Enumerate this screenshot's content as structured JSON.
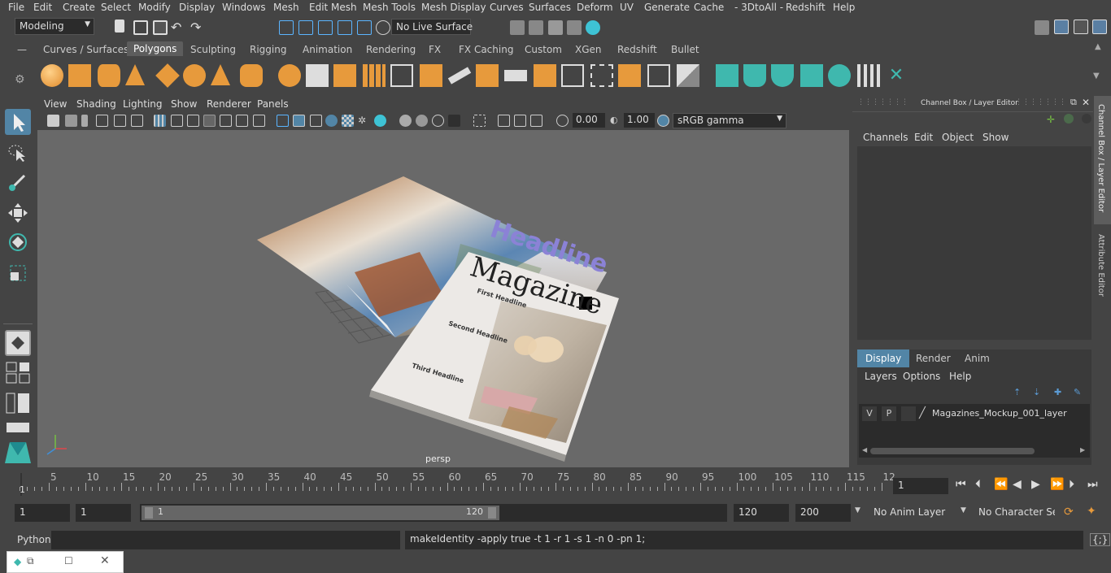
{
  "menubar": {
    "items": [
      "File",
      "Edit",
      "Create",
      "Select",
      "Modify",
      "Display",
      "Windows",
      "Mesh",
      "Edit Mesh",
      "Mesh Tools",
      "Mesh Display",
      "Curves",
      "Surfaces",
      "Deform",
      "UV",
      "Generate",
      "Cache",
      "- 3DtoAll -",
      "Redshift",
      "Help"
    ]
  },
  "statusline": {
    "mode": "Modeling",
    "live_surface": "No Live Surface"
  },
  "shelf": {
    "tabs": [
      "Curves / Surfaces",
      "Polygons",
      "Sculpting",
      "Rigging",
      "Animation",
      "Rendering",
      "FX",
      "FX Caching",
      "Custom",
      "XGen",
      "Redshift",
      "Bullet"
    ],
    "active_tab": "Polygons"
  },
  "panel": {
    "menu": [
      "View",
      "Shading",
      "Lighting",
      "Show",
      "Renderer",
      "Panels"
    ],
    "exposure": "0.00",
    "gamma": "1.00",
    "color_space": "sRGB gamma"
  },
  "viewport": {
    "camera_label": "persp",
    "magazine_headline": "Headline",
    "magazine_title": "Magazine",
    "headings": [
      "First Headline",
      "Second Headline",
      "Third Headline"
    ]
  },
  "channelbox": {
    "title": "Channel Box / Layer Editor",
    "menu": [
      "Channels",
      "Edit",
      "Object",
      "Show"
    ],
    "layer_tabs": [
      "Display",
      "Render",
      "Anim"
    ],
    "active_layer_tab": "Display",
    "layer_menu": [
      "Layers",
      "Options",
      "Help"
    ],
    "layer": {
      "v": "V",
      "p": "P",
      "name": "Magazines_Mockup_001_layer"
    }
  },
  "sidetabs": [
    "Channel Box / Layer Editor",
    "Attribute Editor"
  ],
  "timeslider": {
    "ticks": [
      "5",
      "10",
      "15",
      "20",
      "25",
      "30",
      "35",
      "40",
      "45",
      "50",
      "55",
      "60",
      "65",
      "70",
      "75",
      "80",
      "85",
      "90",
      "95",
      "100",
      "105",
      "110",
      "115",
      "12"
    ],
    "start_marker": "1",
    "current_frame": "1"
  },
  "range": {
    "start": "1",
    "anim_start": "1",
    "slider_start": "1",
    "slider_end": "120",
    "end": "120",
    "anim_end": "200",
    "anim_layer": "No Anim Layer",
    "character_set": "No Character Set"
  },
  "cmdline": {
    "language": "Python",
    "result": "makeIdentity -apply true -t 1 -r 1 -s 1 -n 0 -pn 1;"
  },
  "colors": {
    "bg": "#444444",
    "viewport": "#696969",
    "accent": "#5285a6",
    "shelf_cyan": "#3fb8ae",
    "shelf_orange": "#e79a3c"
  }
}
